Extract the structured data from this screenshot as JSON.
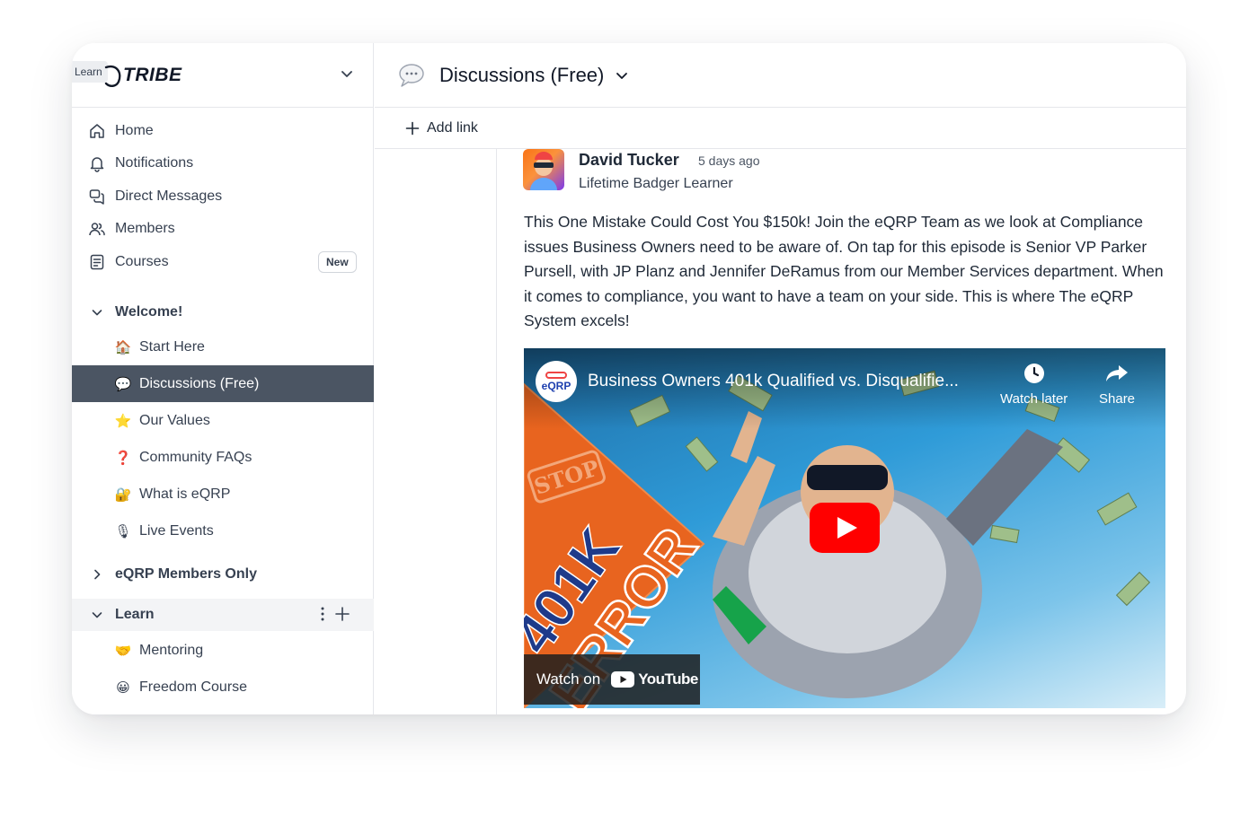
{
  "brand": {
    "learn_tab": "Learn",
    "name": "TRIBE"
  },
  "sidebar": {
    "nav": [
      {
        "label": "Home",
        "icon": "home-icon"
      },
      {
        "label": "Notifications",
        "icon": "bell-icon"
      },
      {
        "label": "Direct Messages",
        "icon": "messages-icon"
      },
      {
        "label": "Members",
        "icon": "members-icon"
      },
      {
        "label": "Courses",
        "icon": "courses-icon",
        "badge": "New"
      }
    ],
    "groups": {
      "welcome": {
        "label": "Welcome!",
        "items": [
          {
            "label": "Start Here",
            "emoji": "🏠"
          },
          {
            "label": "Discussions (Free)",
            "emoji": "💬",
            "active": true
          },
          {
            "label": "Our Values",
            "emoji": "⭐"
          },
          {
            "label": "Community FAQs",
            "emoji": "❓"
          },
          {
            "label": "What is eQRP",
            "emoji": "🔐"
          },
          {
            "label": "Live Events",
            "emoji": "🎙"
          }
        ]
      },
      "members_only": {
        "label": "eQRP Members Only"
      },
      "learn": {
        "label": "Learn",
        "items": [
          {
            "label": "Mentoring",
            "emoji": "🤝"
          },
          {
            "label": "Freedom Course",
            "emoji": "😀"
          }
        ]
      }
    }
  },
  "header": {
    "title": "Discussions (Free)",
    "add_link": "Add link"
  },
  "post": {
    "author": "David Tucker",
    "posted": "5 days ago",
    "member_title": "Lifetime Badger Learner",
    "body": "This One Mistake Could Cost You $150k! Join the eQRP Team as we look at Compliance issues Business Owners need to be aware of. On tap for this episode is Senior VP Parker Pursell, with JP Planz and Jennifer DeRamus from our Member Services department. When it comes to compliance, you want to have a team on your side. This is where The eQRP System excels!",
    "video": {
      "channel": "eQRP",
      "title": "Business Owners 401k Qualified vs. Disqualifie...",
      "watch_later": "Watch later",
      "share": "Share",
      "thumb_stamp": "STOP",
      "thumb_line1": "401K",
      "thumb_line2": "ERROR",
      "watch_on": "Watch on",
      "youtube": "YouTube"
    }
  },
  "colors": {
    "active_bg": "#4b5563",
    "youtube_red": "#ff0000",
    "thumb_orange": "#e8641f"
  }
}
